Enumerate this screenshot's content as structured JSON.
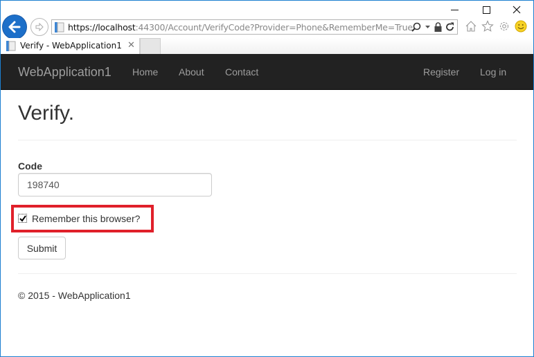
{
  "browser": {
    "window_controls": {
      "minimize": "minimize",
      "maximize": "maximize",
      "close": "close"
    },
    "address": {
      "scheme": "https://",
      "host": "localhost",
      "rest": ":44300/Account/VerifyCode?Provider=Phone&RememberMe=True"
    },
    "tab": {
      "title": "Verify - WebApplication1",
      "close_glyph": "✕"
    },
    "icons": [
      "back-icon",
      "forward-icon",
      "search-icon",
      "dropdown-icon",
      "lock-icon",
      "refresh-icon",
      "home-icon",
      "favorites-star-icon",
      "settings-gear-icon",
      "feedback-smiley-icon"
    ]
  },
  "navbar": {
    "brand": "WebApplication1",
    "left_links": [
      "Home",
      "About",
      "Contact"
    ],
    "right_links": [
      "Register",
      "Log in"
    ]
  },
  "page": {
    "title": "Verify.",
    "code_label": "Code",
    "code_value": "198740",
    "remember_label": "Remember this browser?",
    "remember_checked": true,
    "submit_label": "Submit",
    "footer": "© 2015 - WebApplication1"
  },
  "colors": {
    "navbar_bg": "#222222",
    "navbar_text": "#9d9d9d",
    "highlight_border": "#e0202a",
    "window_border": "#1c7fd0"
  }
}
